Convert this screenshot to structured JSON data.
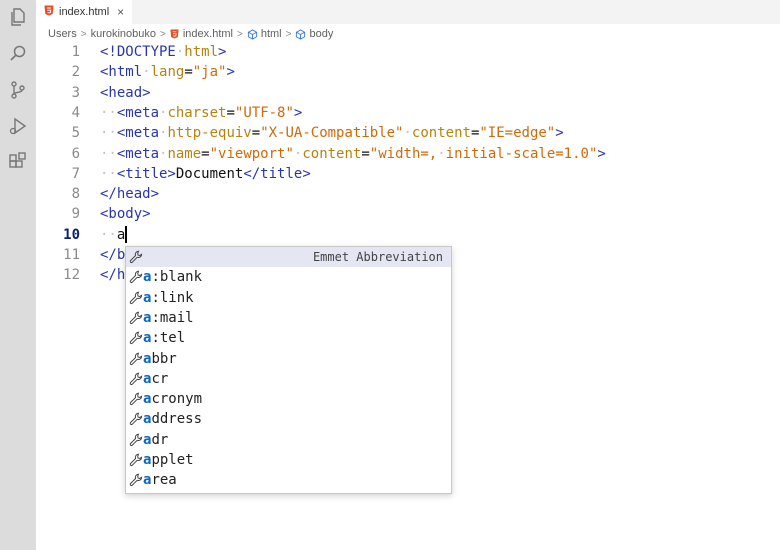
{
  "tab": {
    "filename": "index.html",
    "close": "×"
  },
  "breadcrumb": [
    "Users",
    "kurokinobuko",
    "index.html",
    "html",
    "body"
  ],
  "editor": {
    "line_numbers": [
      "1",
      "2",
      "3",
      "4",
      "5",
      "6",
      "7",
      "8",
      "9",
      "10",
      "11",
      "12"
    ],
    "active_line": "10",
    "lines": [
      {
        "indent": 0,
        "tokens": [
          {
            "c": "t",
            "v": "<!DOCTYPE"
          },
          {
            "c": "ws",
            "v": "·"
          },
          {
            "c": "a",
            "v": "html"
          },
          {
            "c": "t",
            "v": ">"
          }
        ]
      },
      {
        "indent": 0,
        "tokens": [
          {
            "c": "t",
            "v": "<html"
          },
          {
            "c": "ws",
            "v": "·"
          },
          {
            "c": "a",
            "v": "lang"
          },
          {
            "c": "x",
            "v": "="
          },
          {
            "c": "s",
            "v": "\"ja\""
          },
          {
            "c": "t",
            "v": ">"
          }
        ]
      },
      {
        "indent": 0,
        "tokens": [
          {
            "c": "t",
            "v": "<head>"
          }
        ]
      },
      {
        "indent": 1,
        "tokens": [
          {
            "c": "t",
            "v": "<meta"
          },
          {
            "c": "ws",
            "v": "·"
          },
          {
            "c": "a",
            "v": "charset"
          },
          {
            "c": "x",
            "v": "="
          },
          {
            "c": "s",
            "v": "\"UTF-8\""
          },
          {
            "c": "t",
            "v": ">"
          }
        ]
      },
      {
        "indent": 1,
        "tokens": [
          {
            "c": "t",
            "v": "<meta"
          },
          {
            "c": "ws",
            "v": "·"
          },
          {
            "c": "a",
            "v": "http-equiv"
          },
          {
            "c": "x",
            "v": "="
          },
          {
            "c": "s",
            "v": "\"X-UA-Compatible\""
          },
          {
            "c": "ws",
            "v": "·"
          },
          {
            "c": "a",
            "v": "content"
          },
          {
            "c": "x",
            "v": "="
          },
          {
            "c": "s",
            "v": "\"IE=edge\""
          },
          {
            "c": "t",
            "v": ">"
          }
        ]
      },
      {
        "indent": 1,
        "tokens": [
          {
            "c": "t",
            "v": "<meta"
          },
          {
            "c": "ws",
            "v": "·"
          },
          {
            "c": "a",
            "v": "name"
          },
          {
            "c": "x",
            "v": "="
          },
          {
            "c": "s",
            "v": "\"viewport\""
          },
          {
            "c": "ws",
            "v": "·"
          },
          {
            "c": "a",
            "v": "content"
          },
          {
            "c": "x",
            "v": "="
          },
          {
            "c": "s",
            "v": "\"width=,"
          },
          {
            "c": "ws",
            "v": "·"
          },
          {
            "c": "s",
            "v": "initial-scale=1.0\""
          },
          {
            "c": "t",
            "v": ">"
          }
        ]
      },
      {
        "indent": 1,
        "tokens": [
          {
            "c": "t",
            "v": "<title>"
          },
          {
            "c": "x",
            "v": "Document"
          },
          {
            "c": "t",
            "v": "</title>"
          }
        ]
      },
      {
        "indent": 0,
        "tokens": [
          {
            "c": "t",
            "v": "</head>"
          }
        ]
      },
      {
        "indent": 0,
        "tokens": [
          {
            "c": "t",
            "v": "<body>"
          }
        ]
      },
      {
        "indent": 1,
        "tokens": [
          {
            "c": "x",
            "v": "a"
          }
        ],
        "cursor": true
      },
      {
        "indent": 0,
        "tokens": [
          {
            "c": "t",
            "v": "</b"
          }
        ]
      },
      {
        "indent": 0,
        "tokens": [
          {
            "c": "t",
            "v": "</h"
          }
        ]
      }
    ]
  },
  "suggestions": {
    "detail": "Emmet Abbreviation",
    "items": [
      {
        "match": "",
        "rest": ""
      },
      {
        "match": "a",
        "rest": ":blank"
      },
      {
        "match": "a",
        "rest": ":link"
      },
      {
        "match": "a",
        "rest": ":mail"
      },
      {
        "match": "a",
        "rest": ":tel"
      },
      {
        "match": "a",
        "rest": "bbr"
      },
      {
        "match": "a",
        "rest": "cr"
      },
      {
        "match": "a",
        "rest": "cronym"
      },
      {
        "match": "a",
        "rest": "ddress"
      },
      {
        "match": "a",
        "rest": "dr"
      },
      {
        "match": "a",
        "rest": "pplet"
      },
      {
        "match": "a",
        "rest": "rea"
      }
    ]
  },
  "colors": {
    "tag": "#2a36a8",
    "attribute": "#b5830f",
    "string": "#cc6b0a",
    "match": "#0a66c2",
    "activity_bar": "#dcdcdc"
  },
  "icons": [
    "files-icon",
    "search-icon",
    "source-control-icon",
    "run-debug-icon",
    "extensions-icon"
  ]
}
